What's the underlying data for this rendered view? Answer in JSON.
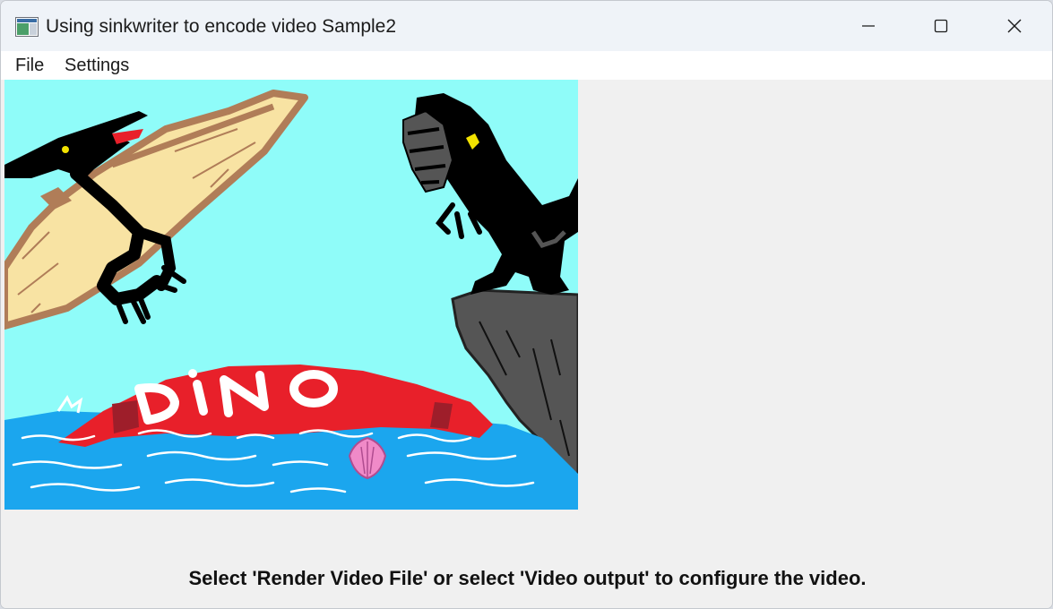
{
  "window": {
    "title": "Using sinkwriter to encode video Sample2",
    "app_icon": "video-sample-app-icon",
    "controls": {
      "minimize_icon": "minimize-icon",
      "maximize_icon": "maximize-icon",
      "close_icon": "close-icon"
    }
  },
  "menu": {
    "items": [
      {
        "label": "File"
      },
      {
        "label": "Settings"
      }
    ]
  },
  "preview": {
    "description_text": "DINO",
    "colors": {
      "sky": "#8ffcf9",
      "water": "#1ba6ee",
      "boat": "#e8202a",
      "cliff": "#555555",
      "wing": "#f8e3a3",
      "wing_outline": "#b07d58",
      "shell": "#f08ac8"
    }
  },
  "status": {
    "message": "Select 'Render Video File' or select 'Video output' to configure the video."
  }
}
